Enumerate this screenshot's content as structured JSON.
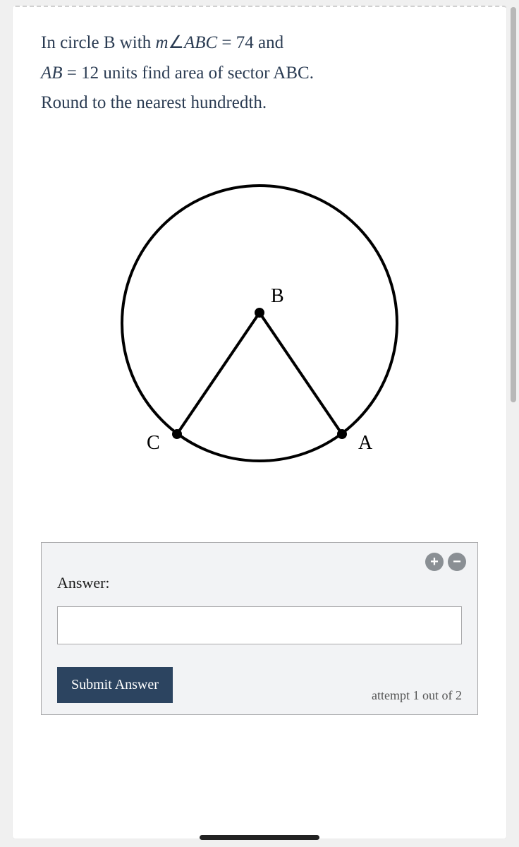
{
  "question": {
    "line1_pre": "In circle B with ",
    "line1_m": "m",
    "line1_angle": "∠",
    "line1_abc": "ABC",
    "line1_eq": " = 74",
    "line1_and": " and",
    "line2_ab": "AB",
    "line2_rest": " = 12 units find area of sector ABC.",
    "line3": "Round to the nearest hundredth."
  },
  "diagram": {
    "label_b": "B",
    "label_a": "A",
    "label_c": "C"
  },
  "answer": {
    "label": "Answer:",
    "value": "",
    "plus_glyph": "+",
    "minus_glyph": "−"
  },
  "submit_label": "Submit Answer",
  "attempt_text": "attempt 1 out of 2",
  "chart_data": {
    "type": "geometry-diagram",
    "shape": "circle-with-sector",
    "center_label": "B",
    "point_labels": [
      "A",
      "C"
    ],
    "angle_ABC_degrees": 74,
    "radius_AB_units": 12,
    "description": "Circle centered at B with radii BA and BC drawn to points A and C on the lower portion of the circle forming a sector."
  }
}
